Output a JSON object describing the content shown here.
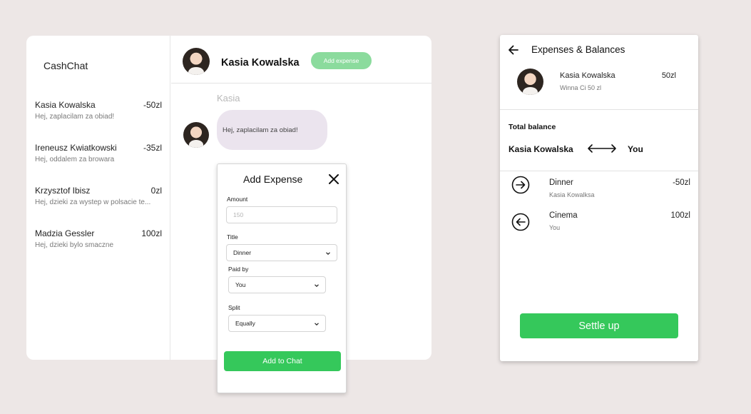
{
  "chat_app": {
    "title": "CashChat",
    "conversations": [
      {
        "name": "Kasia Kowalska",
        "amount": "-50zl",
        "preview": "Hej, zaplacilam za obiad!"
      },
      {
        "name": "Ireneusz Kwiatkowski",
        "amount": "-35zl",
        "preview": "Hej, oddalem za browara"
      },
      {
        "name": "Krzysztof Ibisz",
        "amount": "0zl",
        "preview": "Hej, dzieki za wystep w polsacie te..."
      },
      {
        "name": "Madzia Gessler",
        "amount": "100zl",
        "preview": "Hej, dzieki bylo smaczne"
      }
    ],
    "header": {
      "name": "Kasia Kowalska",
      "add_expense_label": "Add expense"
    },
    "message": {
      "sender": "Kasia",
      "text": "Hej, zaplacilam za obiad!"
    }
  },
  "modal": {
    "title": "Add Expense",
    "amount_label": "Amount",
    "amount_placeholder": "150",
    "title_label": "Title",
    "title_value": "Dinner",
    "paid_by_label": "Paid by",
    "paid_by_value": "You",
    "split_label": "Split",
    "split_value": "Equally",
    "submit_label": "Add to Chat"
  },
  "balances": {
    "title": "Expenses & Balances",
    "contact": {
      "name": "Kasia Kowalska",
      "subtitle": "Winna Ci 50 zl",
      "amount": "50zl"
    },
    "total_label": "Total balance",
    "total_left": "Kasia Kowalska",
    "total_right": "You",
    "transactions": [
      {
        "title": "Dinner",
        "subtitle": "Kasia Kowalksa",
        "amount": "-50zl",
        "direction": "outgoing",
        "icon": "arrow-right-circle-icon"
      },
      {
        "title": "Cinema",
        "subtitle": "You",
        "amount": "100zl",
        "direction": "incoming",
        "icon": "arrow-left-circle-icon"
      }
    ],
    "settle_label": "Settle up"
  },
  "colors": {
    "background": "#ede7e6",
    "accent_green": "#35c85b",
    "pill_green": "#8bdb9d",
    "bubble": "#ebe4ee"
  }
}
